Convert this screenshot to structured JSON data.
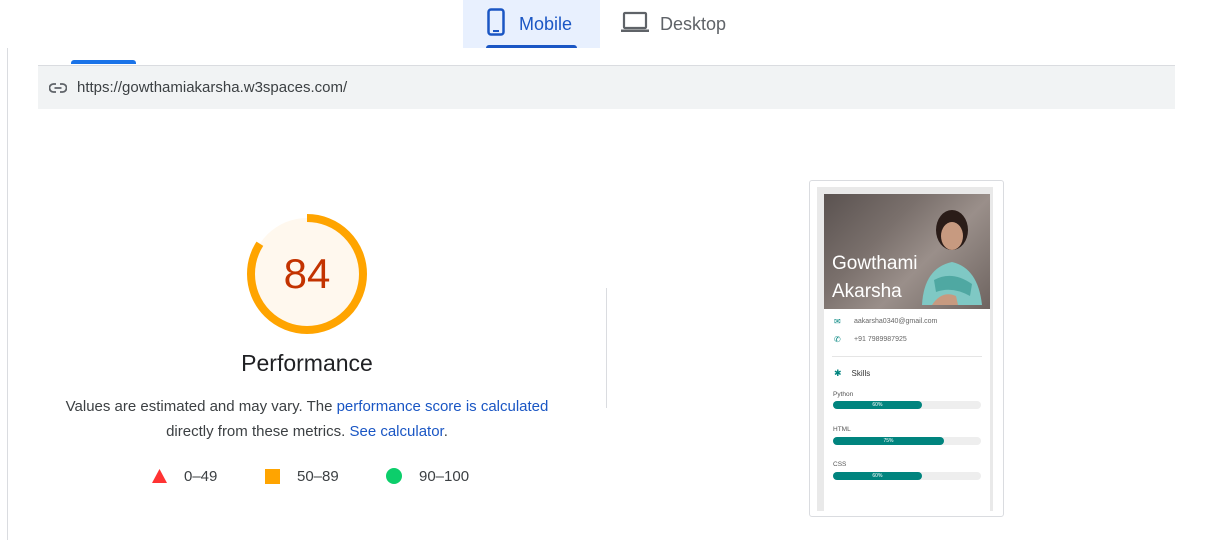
{
  "tabs": {
    "mobile": "Mobile",
    "desktop": "Desktop"
  },
  "url": "https://gowthamiakarsha.w3spaces.com/",
  "score": {
    "value": "84",
    "fraction": 0.84,
    "label": "Performance",
    "color": "#ffa400"
  },
  "description": {
    "text1": "Values are estimated and may vary. The ",
    "link1": "performance score is calculated",
    "text2": "directly from these metrics. ",
    "link2": "See calculator",
    "text3": "."
  },
  "legend": [
    {
      "icon": "triangle-icon",
      "color": "#ff3333",
      "range": "0–49"
    },
    {
      "icon": "square-icon",
      "color": "#ffa400",
      "range": "50–89"
    },
    {
      "icon": "circle-icon",
      "color": "#0cce6b",
      "range": "90–100"
    }
  ],
  "screenshot": {
    "name_line1": "Gowthami",
    "name_line2": "Akarsha",
    "email": "aakarsha0340@gmail.com",
    "phone": "+91 7989987925",
    "skills_title": "Skills",
    "skills": [
      {
        "name": "Python",
        "percent": "60%",
        "value": 0.6
      },
      {
        "name": "HTML",
        "percent": "75%",
        "value": 0.75
      },
      {
        "name": "CSS",
        "percent": "60%",
        "value": 0.6
      }
    ]
  }
}
